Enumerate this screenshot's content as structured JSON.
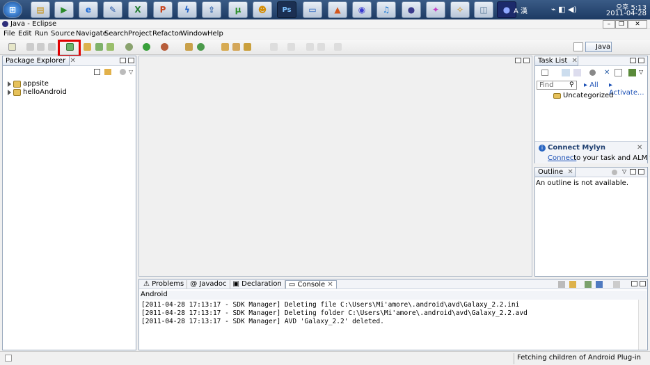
{
  "taskbar": {
    "clock_time": "오후 5:13",
    "clock_date": "2011-04-28",
    "tray_text": "A 漢"
  },
  "window": {
    "title": "Java - Eclipse"
  },
  "menu": [
    "File",
    "Edit",
    "Run",
    "Source",
    "Navigate",
    "Search",
    "Project",
    "Refactor",
    "Window",
    "Help"
  ],
  "perspective": {
    "label": "Java"
  },
  "package_explorer": {
    "title": "Package Explorer",
    "items": [
      "appsite",
      "helloAndroid"
    ]
  },
  "task_list": {
    "title": "Task List",
    "find_placeholder": "Find",
    "all_label": "All",
    "activate_label": "Activate...",
    "category": "Uncategorized"
  },
  "mylyn": {
    "title": "Connect Mylyn",
    "link": "Connect",
    "text": " to your task and ALM tools."
  },
  "outline": {
    "title": "Outline",
    "message": "An outline is not available."
  },
  "bottom_tabs": [
    "Problems",
    "Javadoc",
    "Declaration",
    "Console"
  ],
  "console": {
    "header": "Android",
    "lines": [
      "[2011-04-28 17:13:17 - SDK Manager] Deleting file C:\\Users\\Mi'amore\\.android\\avd\\Galaxy_2.2.ini",
      "[2011-04-28 17:13:17 - SDK Manager] Deleting folder C:\\Users\\Mi'amore\\.android\\avd\\Galaxy_2.2.avd",
      "[2011-04-28 17:13:17 - SDK Manager] AVD 'Galaxy_2.2' deleted."
    ]
  },
  "status": {
    "message": "Fetching children of Android Plug-in"
  }
}
